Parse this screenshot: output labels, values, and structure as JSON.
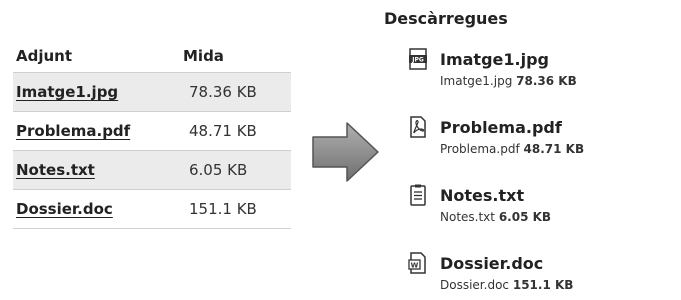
{
  "attachments": {
    "headers": {
      "name": "Adjunt",
      "size": "Mida"
    },
    "rows": [
      {
        "name": "Imatge1.jpg",
        "size": "78.36 KB"
      },
      {
        "name": "Problema.pdf",
        "size": "48.71 KB"
      },
      {
        "name": "Notes.txt",
        "size": "6.05 KB"
      },
      {
        "name": "Dossier.doc",
        "size": "151.1 KB"
      }
    ]
  },
  "arrow": {
    "icon": "right-arrow-icon",
    "color": "#8a8a8a"
  },
  "downloads": {
    "title": "Descàrregues",
    "items": [
      {
        "name": "Imatge1.jpg",
        "filename": "Imatge1.jpg",
        "size": "78.36 KB",
        "icon": "jpg-file-icon"
      },
      {
        "name": "Problema.pdf",
        "filename": "Problema.pdf",
        "size": "48.71 KB",
        "icon": "pdf-file-icon"
      },
      {
        "name": "Notes.txt",
        "filename": "Notes.txt",
        "size": "6.05 KB",
        "icon": "text-file-icon"
      },
      {
        "name": "Dossier.doc",
        "filename": "Dossier.doc",
        "size": "151.1 KB",
        "icon": "word-file-icon"
      }
    ]
  }
}
